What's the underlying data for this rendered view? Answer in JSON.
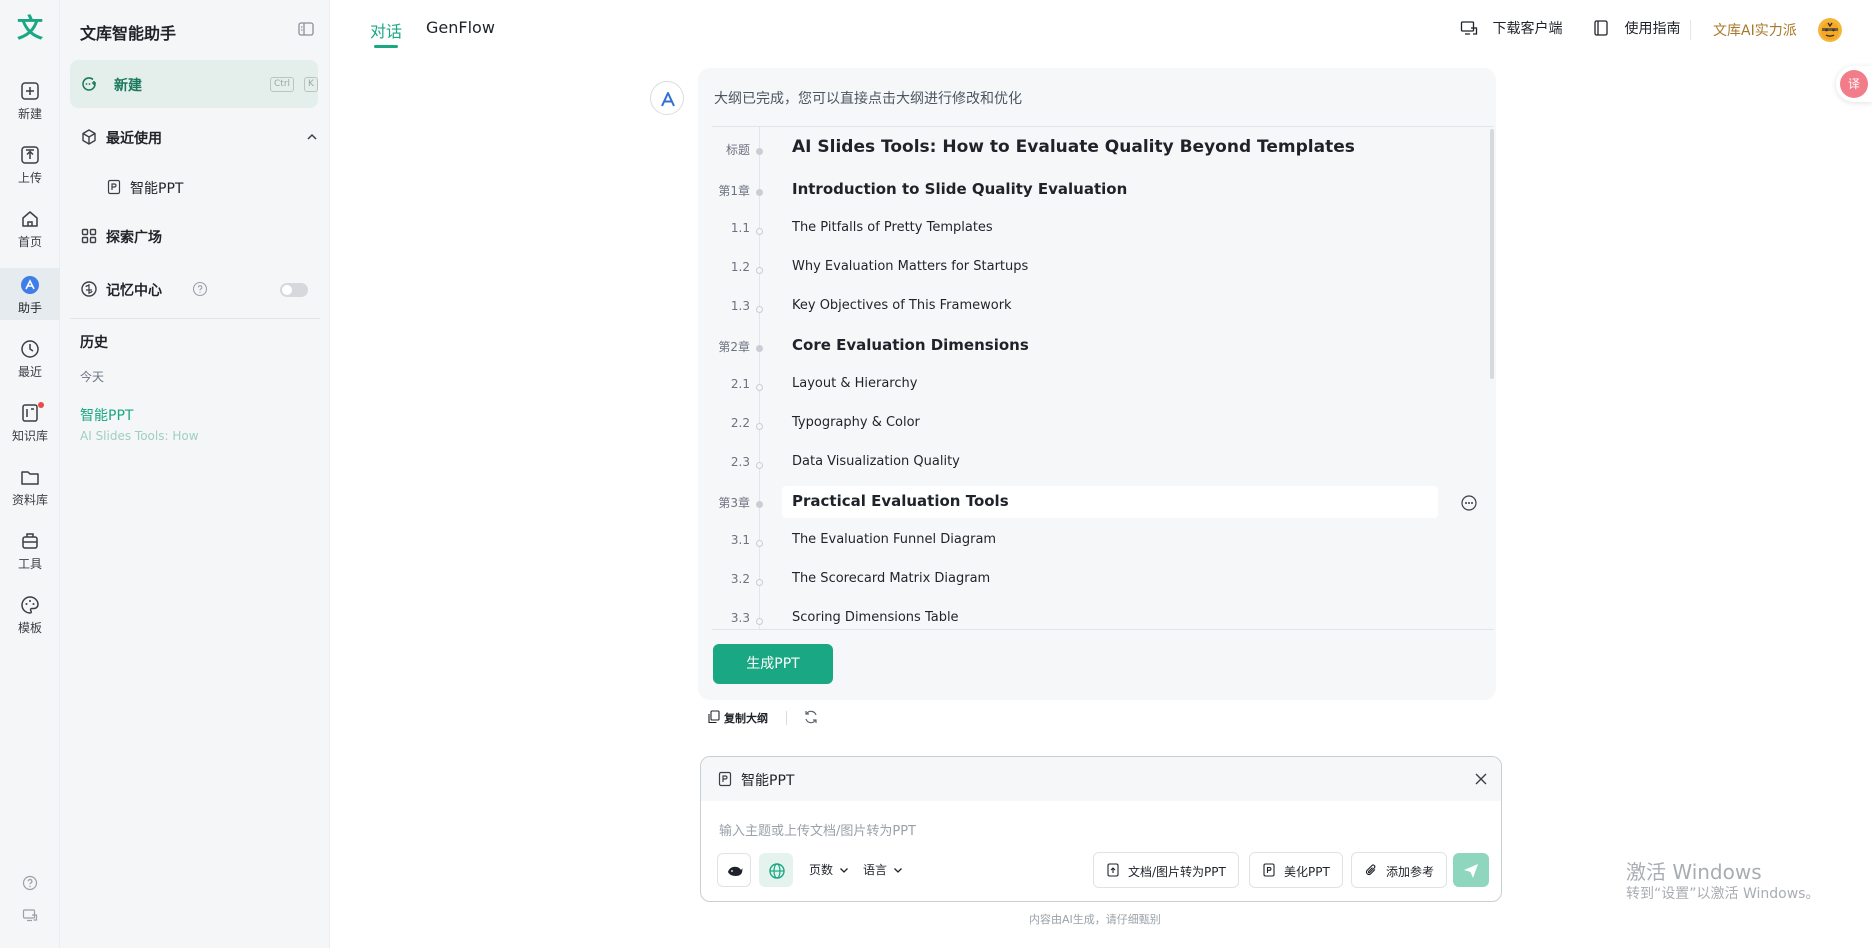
{
  "rail": {
    "logo": "文",
    "items": [
      {
        "label": "新建",
        "icon": "plus-square-icon"
      },
      {
        "label": "上传",
        "icon": "upload-icon"
      },
      {
        "label": "首页",
        "icon": "home-icon"
      },
      {
        "label": "助手",
        "icon": "assistant-icon",
        "active": true
      },
      {
        "label": "最近",
        "icon": "clock-icon"
      },
      {
        "label": "知识库",
        "icon": "knowledge-base-icon",
        "badge": true
      },
      {
        "label": "资料库",
        "icon": "folder-icon"
      },
      {
        "label": "工具",
        "icon": "toolbox-icon"
      },
      {
        "label": "模板",
        "icon": "palette-icon"
      }
    ],
    "bottom_icons": [
      "help-icon",
      "device-icon"
    ]
  },
  "sidebar": {
    "title": "文库智能助手",
    "new_label": "新建",
    "shortcut": [
      "Ctrl",
      "K"
    ],
    "recent_label": "最近使用",
    "recent_item": "智能PPT",
    "explore_label": "探索广场",
    "memory_label": "记忆中心",
    "memory_enabled": false,
    "history_title": "历史",
    "history_day": "今天",
    "history_item_title": "智能PPT",
    "history_item_sub": "AI Slides Tools: How"
  },
  "header": {
    "tabs": [
      "对话",
      "GenFlow"
    ],
    "active_tab": "对话",
    "download_label": "下载客户端",
    "guide_label": "使用指南",
    "brand_link": "文库AI实力派"
  },
  "float_badge": "译",
  "message": {
    "intro": "大纲已完成，您可以直接点击大纲进行修改和优化",
    "outline": [
      {
        "num": "标题",
        "text": "AI Slides Tools: How to Evaluate Quality Beyond Templates",
        "level": 0
      },
      {
        "num": "第1章",
        "text": "Introduction to Slide Quality Evaluation",
        "level": 1
      },
      {
        "num": "1.1",
        "text": "The Pitfalls of Pretty Templates",
        "level": 2
      },
      {
        "num": "1.2",
        "text": "Why Evaluation Matters for Startups",
        "level": 2
      },
      {
        "num": "1.3",
        "text": "Key Objectives of This Framework",
        "level": 2
      },
      {
        "num": "第2章",
        "text": "Core Evaluation Dimensions",
        "level": 1
      },
      {
        "num": "2.1",
        "text": "Layout & Hierarchy",
        "level": 2
      },
      {
        "num": "2.2",
        "text": "Typography & Color",
        "level": 2
      },
      {
        "num": "2.3",
        "text": "Data Visualization Quality",
        "level": 2
      },
      {
        "num": "第3章",
        "text": "Practical Evaluation Tools",
        "level": 1,
        "hover": true
      },
      {
        "num": "3.1",
        "text": "The Evaluation Funnel Diagram",
        "level": 2
      },
      {
        "num": "3.2",
        "text": "The Scorecard Matrix Diagram",
        "level": 2
      },
      {
        "num": "3.3",
        "text": "Scoring Dimensions Table",
        "level": 2
      }
    ],
    "generate_label": "生成PPT",
    "copy_label": "复制大纲"
  },
  "composer": {
    "mode_label": "智能PPT",
    "placeholder": "输入主题或上传文档/图片转为PPT",
    "pages_label": "页数",
    "language_label": "语言",
    "doc_to_ppt_label": "文档/图片转为PPT",
    "beautify_label": "美化PPT",
    "add_ref_label": "添加参考"
  },
  "disclaimer": "内容由AI生成，请仔细甄别",
  "watermark": {
    "line1": "激活 Windows",
    "line2": "转到“设置”以激活 Windows。"
  },
  "colors": {
    "accent": "#1aa784",
    "accent_light": "#e4efeb",
    "brand_gold": "#a8792b",
    "send_disabled": "#8fd6be"
  }
}
